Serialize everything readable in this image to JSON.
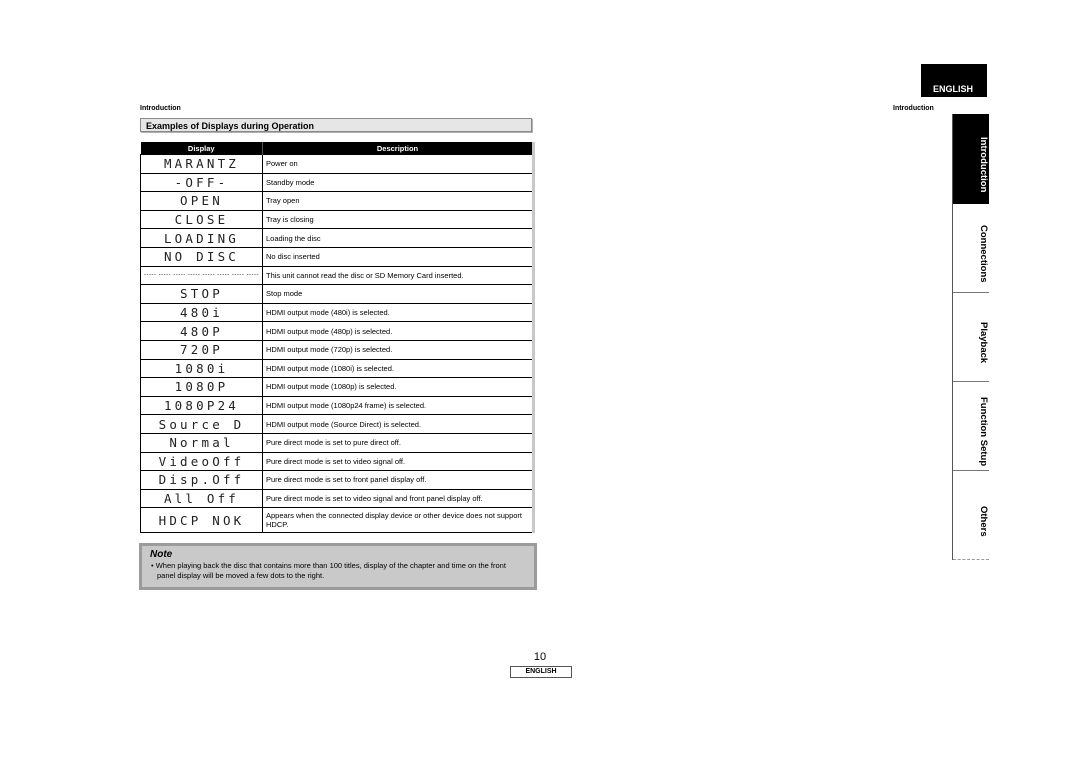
{
  "header": {
    "left_section_label": "Introduction",
    "right_section_label": "Introduction",
    "language_tab": "ENGLISH"
  },
  "section_title": "Examples of Displays during Operation",
  "table": {
    "columns": [
      "Display",
      "Description"
    ],
    "rows": [
      {
        "display": "MARANTZ",
        "description": "Power on"
      },
      {
        "display": "-OFF-",
        "description": "Standby mode"
      },
      {
        "display": "OPEN",
        "description": "Tray open"
      },
      {
        "display": "CLOSE",
        "description": "Tray is closing"
      },
      {
        "display": "LOADING",
        "description": "Loading the disc"
      },
      {
        "display": "NO DISC",
        "description": "No disc inserted"
      },
      {
        "display": "----- ----- ----- ----- ----- ----- ----- -----",
        "description": "This unit cannot read the disc or SD Memory Card inserted."
      },
      {
        "display": "STOP",
        "description": "Stop mode"
      },
      {
        "display": "480i",
        "description": "HDMI output mode (480i) is selected."
      },
      {
        "display": "480P",
        "description": "HDMI output mode (480p) is selected."
      },
      {
        "display": "720P",
        "description": "HDMI output mode (720p) is selected."
      },
      {
        "display": "1080i",
        "description": "HDMI output mode (1080i) is selected."
      },
      {
        "display": "1080P",
        "description": "HDMI output mode (1080p) is selected."
      },
      {
        "display": "1080P24",
        "description": "HDMI output mode (1080p24 frame) is selected."
      },
      {
        "display": "Source D",
        "description": "HDMI output mode (Source Direct) is selected."
      },
      {
        "display": "Normal",
        "description": "Pure direct mode is set to pure direct off."
      },
      {
        "display": "VideoOff",
        "description": "Pure direct mode is set to video signal off."
      },
      {
        "display": "Disp.Off",
        "description": "Pure direct mode is set to front panel display off."
      },
      {
        "display": "All Off",
        "description": "Pure direct mode is set to video signal and front panel display off."
      },
      {
        "display": "HDCP NOK",
        "description": "Appears when the connected display device or other device does not support HDCP."
      }
    ]
  },
  "note": {
    "title": "Note",
    "items": [
      "When playing back the disc that contains more than 100 titles, display of the chapter and time on the front panel display will be moved a few dots to the right."
    ]
  },
  "side_tabs": [
    {
      "label": "Introduction",
      "active": true
    },
    {
      "label": "Connections",
      "active": false
    },
    {
      "label": "Playback",
      "active": false
    },
    {
      "label": "Function Setup",
      "active": false
    },
    {
      "label": "Others",
      "active": false
    }
  ],
  "footer": {
    "page_number": "10",
    "language": "ENGLISH"
  }
}
